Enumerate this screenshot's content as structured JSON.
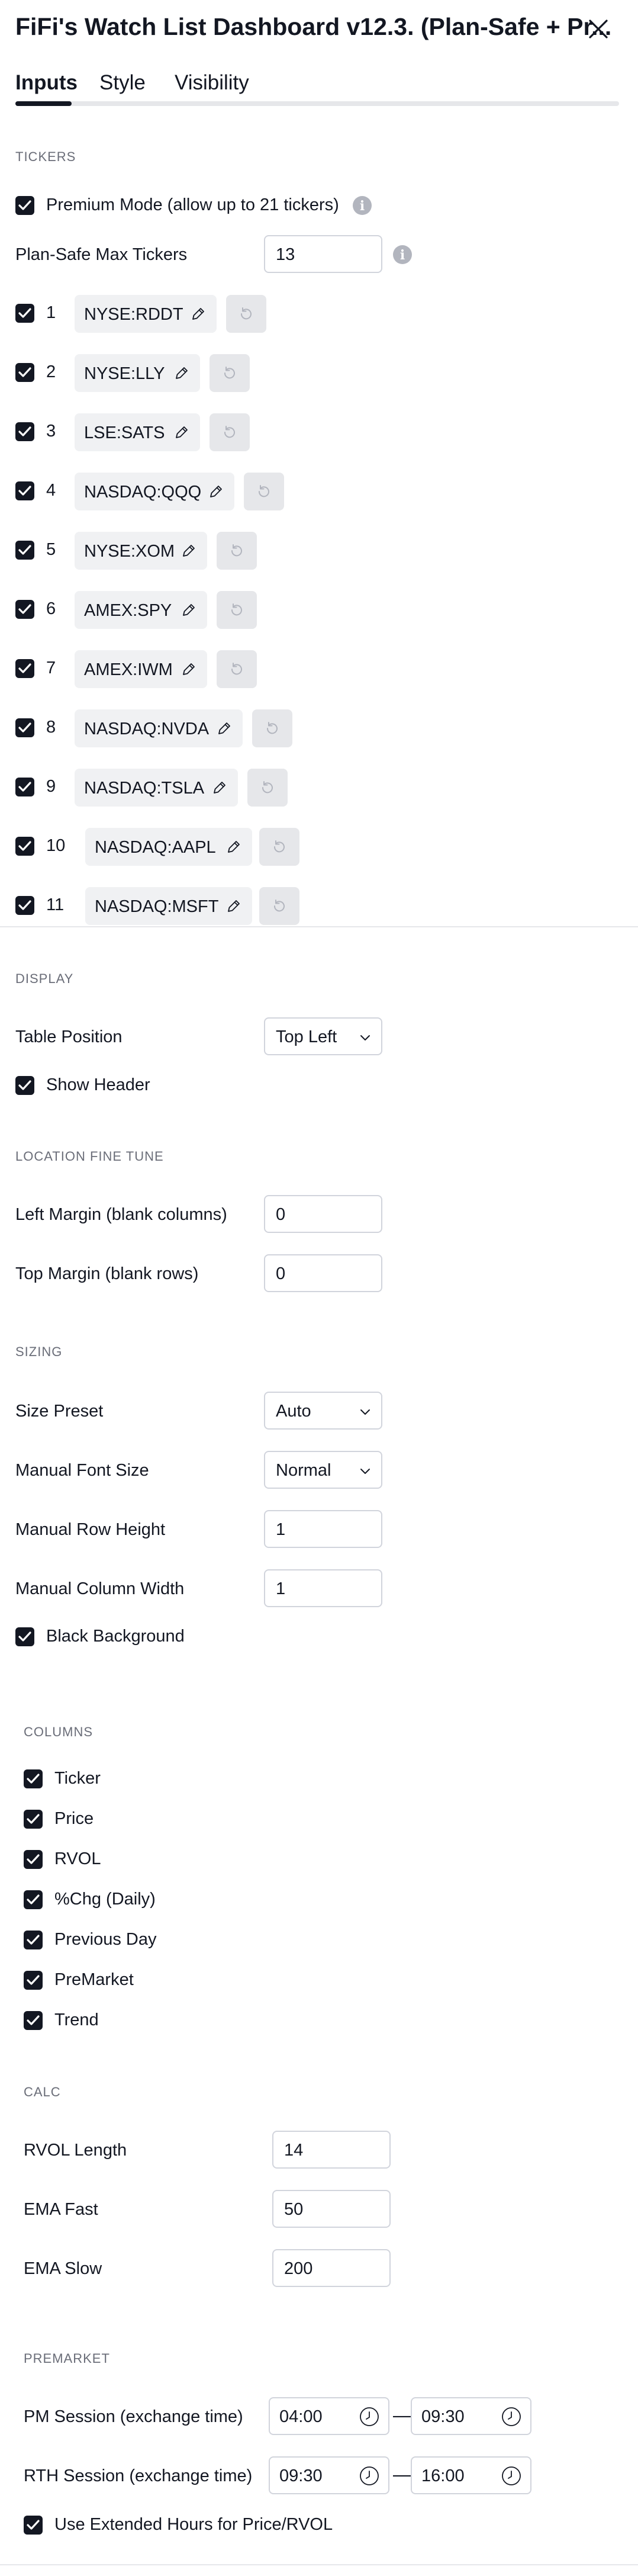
{
  "window": {
    "title": "FiFi's Watch List Dashboard v12.3. (Plan-Safe + Pr..."
  },
  "tabs": [
    {
      "label": "Inputs",
      "active": true
    },
    {
      "label": "Style",
      "active": false
    },
    {
      "label": "Visibility",
      "active": false
    }
  ],
  "tickers_section": {
    "heading": "TICKERS",
    "premium_mode": {
      "label": "Premium Mode (allow up to 21 tickers)",
      "checked": true
    },
    "max_tickers": {
      "label": "Plan-Safe Max Tickers",
      "value": "13"
    },
    "rows": [
      {
        "num": "1",
        "symbol": "NYSE:RDDT",
        "checked": true
      },
      {
        "num": "2",
        "symbol": "NYSE:LLY",
        "checked": true
      },
      {
        "num": "3",
        "symbol": "LSE:SATS",
        "checked": true
      },
      {
        "num": "4",
        "symbol": "NASDAQ:QQQ",
        "checked": true
      },
      {
        "num": "5",
        "symbol": "NYSE:XOM",
        "checked": true
      },
      {
        "num": "6",
        "symbol": "AMEX:SPY",
        "checked": true
      },
      {
        "num": "7",
        "symbol": "AMEX:IWM",
        "checked": true
      },
      {
        "num": "8",
        "symbol": "NASDAQ:NVDA",
        "checked": true
      },
      {
        "num": "9",
        "symbol": "NASDAQ:TSLA",
        "checked": true
      },
      {
        "num": "10",
        "symbol": "NASDAQ:AAPL",
        "checked": true
      },
      {
        "num": "11",
        "symbol": "NASDAQ:MSFT",
        "checked": true
      }
    ]
  },
  "display": {
    "heading": "DISPLAY",
    "table_position": {
      "label": "Table Position",
      "value": "Top Left"
    },
    "show_header": {
      "label": "Show Header",
      "checked": true
    }
  },
  "location": {
    "heading": "LOCATION FINE TUNE",
    "left_margin": {
      "label": "Left Margin (blank columns)",
      "value": "0"
    },
    "top_margin": {
      "label": "Top Margin (blank rows)",
      "value": "0"
    }
  },
  "sizing": {
    "heading": "SIZING",
    "size_preset": {
      "label": "Size Preset",
      "value": "Auto"
    },
    "font_size": {
      "label": "Manual Font Size",
      "value": "Normal"
    },
    "row_height": {
      "label": "Manual Row Height",
      "value": "1"
    },
    "col_width": {
      "label": "Manual Column Width",
      "value": "1"
    },
    "black_bg": {
      "label": "Black Background",
      "checked": true
    }
  },
  "columns": {
    "heading": "COLUMNS",
    "items": [
      {
        "label": "Ticker",
        "checked": true
      },
      {
        "label": "Price",
        "checked": true
      },
      {
        "label": "RVOL",
        "checked": true
      },
      {
        "label": "%Chg (Daily)",
        "checked": true
      },
      {
        "label": "Previous Day",
        "checked": true
      },
      {
        "label": "PreMarket",
        "checked": true
      },
      {
        "label": "Trend",
        "checked": true
      }
    ]
  },
  "calc": {
    "heading": "CALC",
    "rvol_length": {
      "label": "RVOL Length",
      "value": "14"
    },
    "ema_fast": {
      "label": "EMA Fast",
      "value": "50"
    },
    "ema_slow": {
      "label": "EMA Slow",
      "value": "200"
    }
  },
  "premarket": {
    "heading": "PREMARKET",
    "pm_session": {
      "label": "PM Session (exchange time)",
      "start": "04:00",
      "end": "09:30"
    },
    "rth_session": {
      "label": "RTH Session (exchange time)",
      "start": "09:30",
      "end": "16:00"
    },
    "separator": "—",
    "extended_hours": {
      "label": "Use Extended Hours for Price/RVOL",
      "checked": true
    }
  },
  "colors": {
    "accent": "#131722",
    "chip_bg": "#f0f1f3",
    "border": "#d1d4dc",
    "muted": "#6a6d78"
  }
}
